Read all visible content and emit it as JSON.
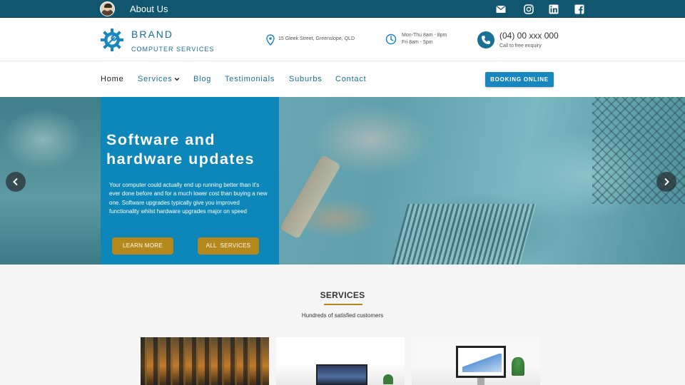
{
  "topbar": {
    "about_label": "About Us",
    "icons": [
      "mail-icon",
      "instagram-icon",
      "linkedin-icon",
      "facebook-icon"
    ],
    "background": "#10566e"
  },
  "header": {
    "brand": "BRAND",
    "brand_sub": "COMPUTER SERVICES",
    "address": "15 Gleek Street, Greenslope, QLD",
    "hours_line1": "Mon-Thu 8am - 8pm",
    "hours_line2": "Fri 8am - 5pm",
    "phone": "(04) 00 xxx 000",
    "phone_sub": "Call to free enquiry",
    "accent": "#1a6f96"
  },
  "nav": {
    "items": [
      {
        "label": "Home"
      },
      {
        "label": "Services"
      },
      {
        "label": "Blog"
      },
      {
        "label": "Testimonials"
      },
      {
        "label": "Suburbs"
      },
      {
        "label": "Contact"
      }
    ],
    "booking_label": "BOOKING ONLINE"
  },
  "hero": {
    "title": "Software and hardware updates",
    "text": "Your computer could actually end up running better than it's ever done before and for a much lower cost than buying a new one. Software upgrades typically give you improved functionality whilst hardware upgrades major on speed",
    "learn_more": "LEARN MORE",
    "all_services": "ALL  SERVICES",
    "panel_color": "#0d86b9",
    "button_color": "#b4881a"
  },
  "services": {
    "title": "SERVICES",
    "subtitle": "Hundreds of satisfied customers"
  }
}
